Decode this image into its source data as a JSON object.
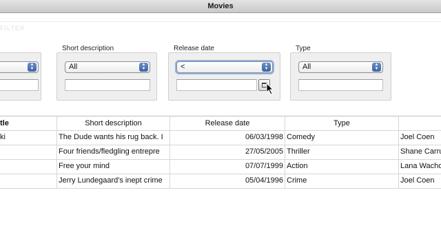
{
  "window": {
    "title": "Movies"
  },
  "filters": {
    "hint": "FILTER",
    "title_group": {
      "combo_value": ""
    },
    "short_description": {
      "label": "Short description",
      "combo_value": "All"
    },
    "release_date": {
      "label": "Release date",
      "combo_value": "<"
    },
    "type": {
      "label": "Type",
      "combo_value": "All"
    }
  },
  "table": {
    "headers": [
      "tle",
      "Short description",
      "Release date",
      "Type",
      ""
    ],
    "rows": [
      {
        "title": "ki",
        "short_description": "The Dude wants his rug back. I",
        "release_date": "06/03/1998",
        "type": "Comedy",
        "director": "Joel Coen"
      },
      {
        "title": "",
        "short_description": "Four friends/fledgling entrepre",
        "release_date": "27/05/2005",
        "type": "Thriller",
        "director": "Shane Carru"
      },
      {
        "title": "",
        "short_description": "Free your mind",
        "release_date": "07/07/1999",
        "type": "Action",
        "director": "Lana Wacho"
      },
      {
        "title": "",
        "short_description": "Jerry Lundegaard's inept crime",
        "release_date": "05/04/1996",
        "type": "Crime",
        "director": "Joel Coen"
      }
    ]
  },
  "icons": {
    "calendar": "calendar-icon",
    "cursor": "mouse-pointer-icon",
    "combo_arrows": "updown-arrows-icon"
  }
}
